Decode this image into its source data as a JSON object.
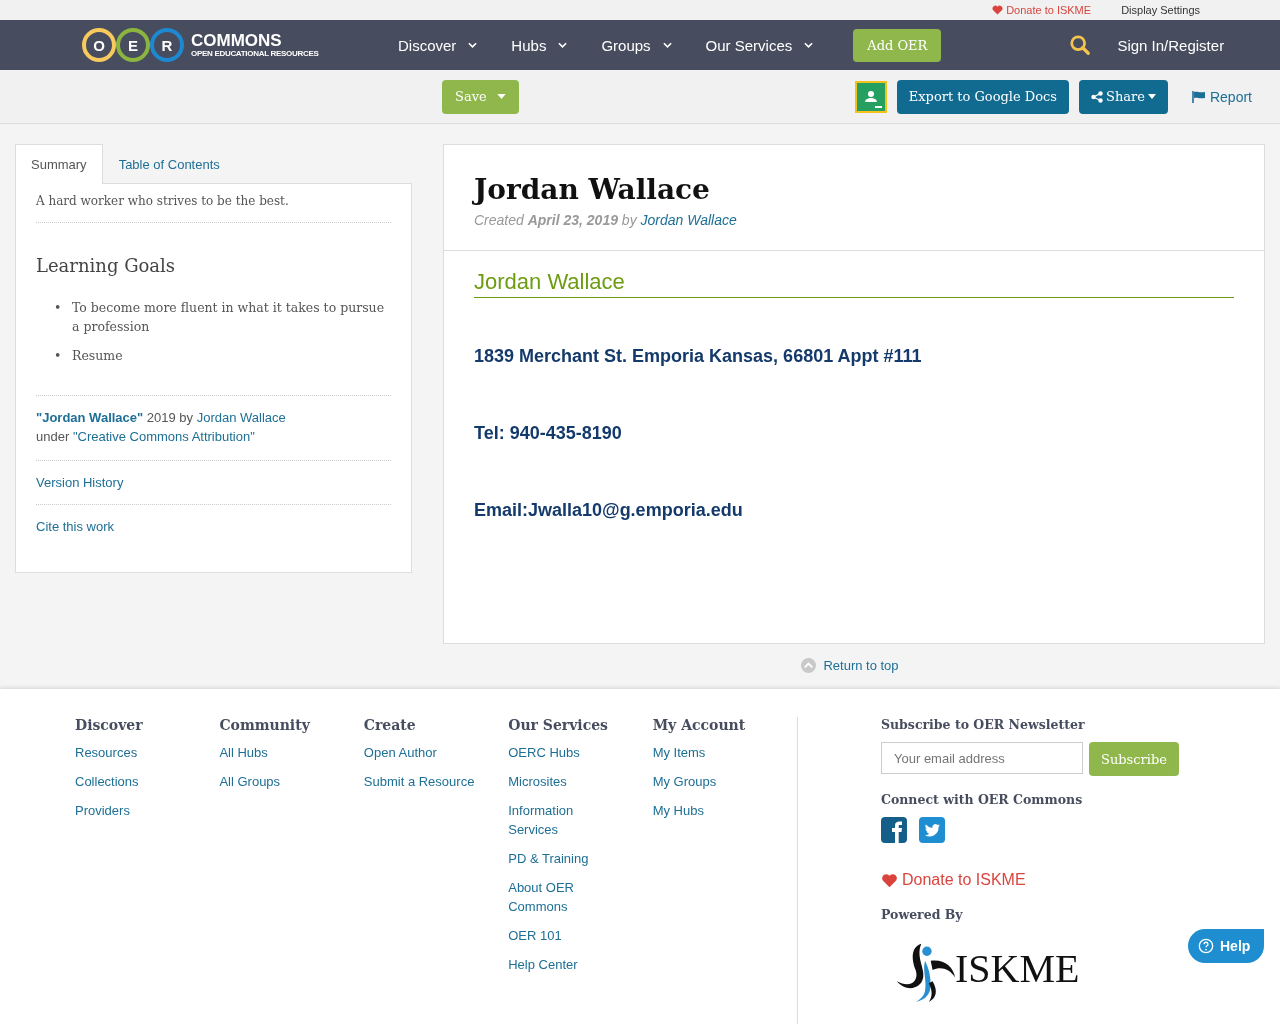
{
  "top_bar": {
    "donate": "Donate to ISKME",
    "display_settings": "Display Settings"
  },
  "logo": {
    "letters": [
      {
        "char": "O",
        "color": "#f8c95c"
      },
      {
        "char": "E",
        "color": "#8cb53f"
      },
      {
        "char": "R",
        "color": "#1e88d0"
      }
    ],
    "name": "COMMONS",
    "tagline": "OPEN EDUCATIONAL RESOURCES"
  },
  "nav": {
    "items": [
      {
        "label": "Discover"
      },
      {
        "label": "Hubs"
      },
      {
        "label": "Groups"
      },
      {
        "label": "Our Services"
      }
    ],
    "add_button": "Add OER",
    "sign_in": "Sign In/Register"
  },
  "toolbar": {
    "save": "Save",
    "export": "Export to Google Docs",
    "share": "Share",
    "report": "Report"
  },
  "sidebar": {
    "tabs": [
      {
        "label": "Summary",
        "selected": true
      },
      {
        "label": "Table of Contents",
        "selected": false
      }
    ],
    "description": "A hard worker who strives to be the best.",
    "goals_heading": "Learning Goals",
    "goals": [
      {
        "marker": "•",
        "text": "To become more fluent in what it takes to pursue a profession"
      },
      {
        "marker": "•",
        "text": "Resume"
      }
    ],
    "attribution": {
      "title": "\"Jordan Wallace\"",
      "middle": " 2019 by ",
      "author": "Jordan Wallace",
      "under": "under ",
      "license": "\"Creative Commons Attribution\""
    },
    "links": [
      "Version History",
      "Cite this work"
    ]
  },
  "resource": {
    "title": "Jordan Wallace",
    "created": "Created **April 23, 2019** by",
    "author": "Jordan Wallace",
    "heading": "Jordan Wallace",
    "lines": [
      "1839 Merchant St. Emporia Kansas, 66801 Appt #111",
      "Tel: 940-435-8190",
      "Email:Jwalla10@g.emporia.edu"
    ]
  },
  "return_top": "Return to top",
  "footer": {
    "columns": [
      {
        "heading": "Discover",
        "links": [
          "Resources",
          "Collections",
          "Providers"
        ]
      },
      {
        "heading": "Community",
        "links": [
          "All Hubs",
          "All Groups"
        ]
      },
      {
        "heading": "Create",
        "links": [
          "Open Author",
          "Submit a Resource"
        ]
      },
      {
        "heading": "Our Services",
        "links": [
          "OERC Hubs",
          "Microsites",
          "Information Services",
          "PD & Training",
          "About OER Commons",
          "OER 101",
          "Help Center"
        ]
      },
      {
        "heading": "My Account",
        "links": [
          "My Items",
          "My Groups",
          "My Hubs"
        ]
      }
    ],
    "newsletter": {
      "heading": "Subscribe to OER Newsletter",
      "placeholder": "Your email address",
      "button": "Subscribe"
    },
    "connect_heading": "Connect with OER Commons",
    "donate": "Donate to ISKME",
    "powered_by": "Powered By",
    "iskme_logo": "ISKME"
  },
  "help_button": "Help"
}
